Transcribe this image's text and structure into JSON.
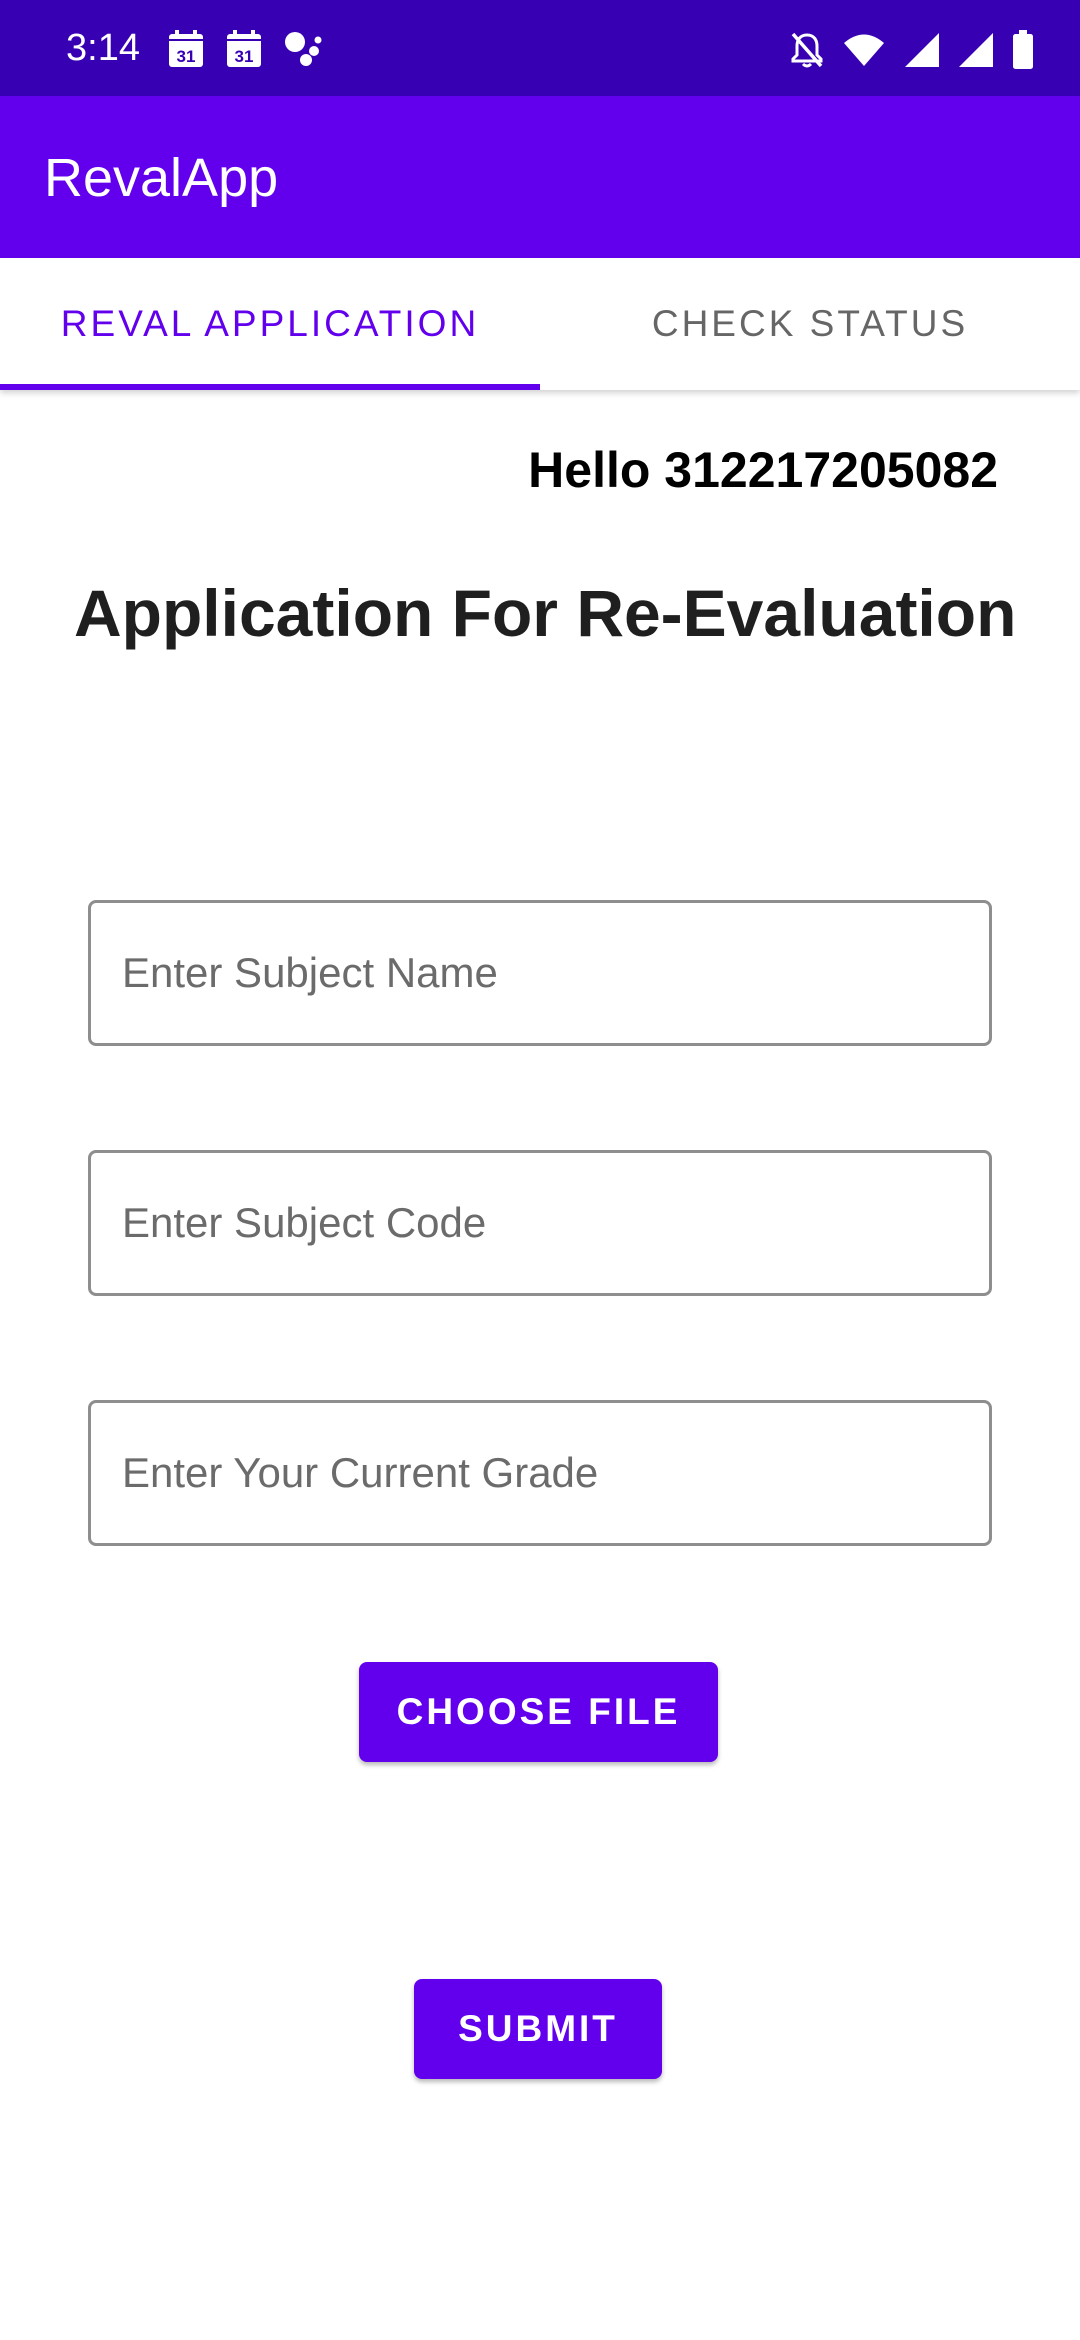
{
  "status_bar": {
    "time": "3:14",
    "calendar_day_1": "31",
    "calendar_day_2": "31",
    "left_icons": [
      "calendar-icon",
      "calendar-icon",
      "assistant-icon"
    ],
    "right_icons": [
      "notifications-off-icon",
      "wifi-icon",
      "signal-icon",
      "signal-icon",
      "battery-icon"
    ]
  },
  "app_bar": {
    "title": "RevalApp"
  },
  "tabs": [
    {
      "label": "REVAL APPLICATION",
      "active": true
    },
    {
      "label": "CHECK STATUS",
      "active": false
    }
  ],
  "main": {
    "greeting": "Hello 312217205082",
    "title": "Application For Re-Evaluation",
    "fields": {
      "subject_name": {
        "value": "",
        "placeholder": "Enter Subject Name"
      },
      "subject_code": {
        "value": "",
        "placeholder": "Enter Subject Code"
      },
      "current_grade": {
        "value": "",
        "placeholder": "Enter Your Current Grade"
      }
    },
    "choose_file_label": "CHOOSE FILE",
    "submit_label": "SUBMIT"
  },
  "colors": {
    "status_bar": "#3700b3",
    "primary": "#6200ee",
    "text_dark": "#1f1f1f",
    "tab_inactive": "#666666"
  }
}
